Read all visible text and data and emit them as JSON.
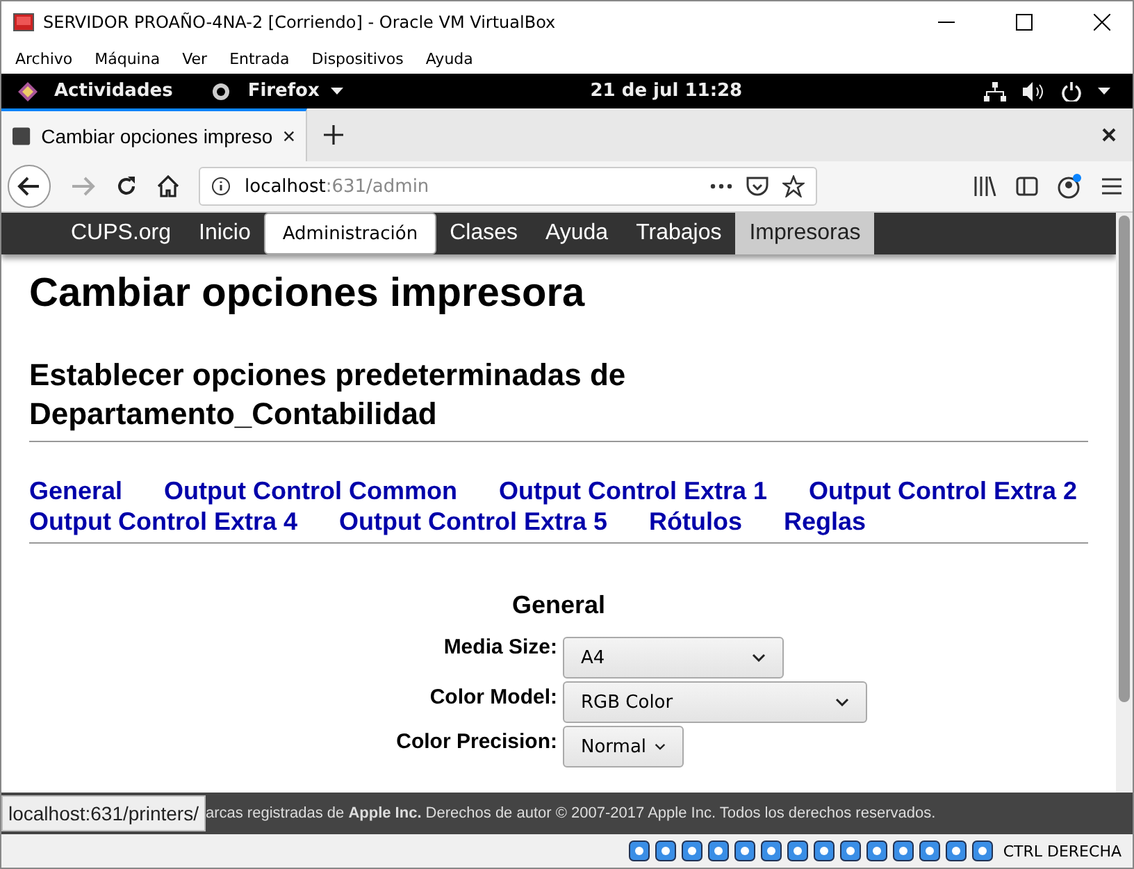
{
  "window": {
    "title": "SERVIDOR PROAÑO-4NA-2 [Corriendo] - Oracle VM VirtualBox"
  },
  "menu": [
    "Archivo",
    "Máquina",
    "Ver",
    "Entrada",
    "Dispositivos",
    "Ayuda"
  ],
  "top_bar": {
    "activities": "Actividades",
    "app": "Firefox",
    "clock": "21 de jul  11:28"
  },
  "browser": {
    "tab_title": "Cambiar opciones impreso",
    "url_host": "localhost",
    "url_rest": ":631/admin"
  },
  "cups_nav": [
    {
      "label": "CUPS.org",
      "selected": false,
      "hovered": false
    },
    {
      "label": "Inicio",
      "selected": false,
      "hovered": false
    },
    {
      "label": "Administración",
      "selected": true,
      "hovered": false
    },
    {
      "label": "Clases",
      "selected": false,
      "hovered": false
    },
    {
      "label": "Ayuda",
      "selected": false,
      "hovered": false
    },
    {
      "label": "Trabajos",
      "selected": false,
      "hovered": false
    },
    {
      "label": "Impresoras",
      "selected": false,
      "hovered": true
    }
  ],
  "page": {
    "title": "Cambiar opciones impresora",
    "subtitle": "Establecer opciones predeterminadas de Departamento_Contabilidad",
    "sections": [
      "General",
      "Output Control Common",
      "Output Control Extra 1",
      "Output Control Extra 2",
      "Output Control Extra 4",
      "Output Control Extra 5",
      "Rótulos",
      "Reglas"
    ],
    "form_heading": "General",
    "fields": [
      {
        "label": "Media Size:",
        "value": "A4"
      },
      {
        "label": "Color Model:",
        "value": "RGB Color"
      },
      {
        "label": "Color Precision:",
        "value": "Normal"
      }
    ]
  },
  "footer": "arcas registradas de **Apple Inc.** Derechos de autor © 2007-2017 Apple Inc. Todos los derechos reservados.",
  "status_url": "localhost:631/printers/",
  "vbox_status": {
    "host_key": "CTRL DERECHA"
  }
}
